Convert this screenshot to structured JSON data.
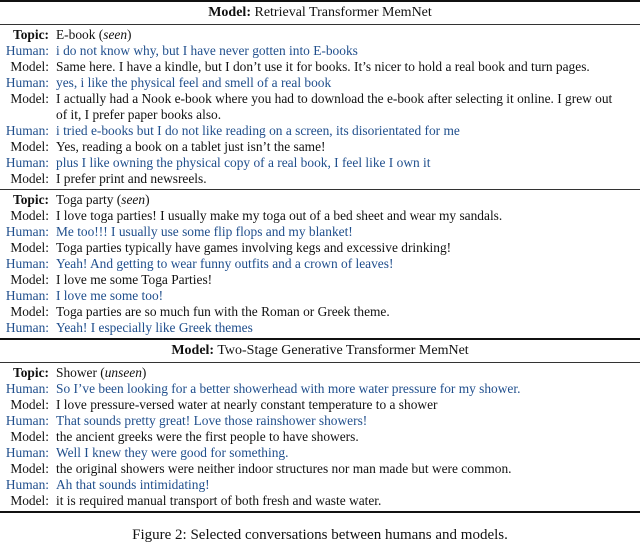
{
  "colors": {
    "human_text": "#1f4e8c",
    "model_text": "#111111"
  },
  "blocks": [
    {
      "model_label": "Model:",
      "model_name": "Retrieval Transformer MemNet",
      "sections": [
        {
          "topic_label": "Topic:",
          "topic": "E-book",
          "topic_status": "seen",
          "turns": [
            {
              "speaker": "Human:",
              "text": "i do not know why, but I have never gotten into E-books"
            },
            {
              "speaker": "Model:",
              "text": "Same here. I have a kindle, but I don’t use it for books. It’s nicer to hold a real book and turn pages."
            },
            {
              "speaker": "Human:",
              "text": "yes, i like the physical feel and smell of a real book"
            },
            {
              "speaker": "Model:",
              "text": "I actually had a Nook e-book where you had to download the e-book after selecting it online. I grew out of it, I prefer paper books also."
            },
            {
              "speaker": "Human:",
              "text": "i tried e-books but I do not like reading on a screen, its disorientated for me"
            },
            {
              "speaker": "Model:",
              "text": "Yes, reading a book on a tablet just isn’t the same!"
            },
            {
              "speaker": "Human:",
              "text": "plus I like owning the physical copy of a real book, I feel like I own it"
            },
            {
              "speaker": "Model:",
              "text": "I prefer print and newsreels."
            }
          ]
        },
        {
          "topic_label": "Topic:",
          "topic": "Toga party",
          "topic_status": "seen",
          "turns": [
            {
              "speaker": "Model:",
              "text": "I love toga parties! I usually make my toga out of a bed sheet and wear my sandals."
            },
            {
              "speaker": "Human:",
              "text": "Me too!!! I usually use some flip flops and my blanket!"
            },
            {
              "speaker": "Model:",
              "text": "Toga parties typically have games involving kegs and excessive drinking!"
            },
            {
              "speaker": "Human:",
              "text": "Yeah! And getting to wear funny outfits and a crown of leaves!"
            },
            {
              "speaker": "Model:",
              "text": "I love me some Toga Parties!"
            },
            {
              "speaker": "Human:",
              "text": "I love me some too!"
            },
            {
              "speaker": "Model:",
              "text": "Toga parties are so much fun with the Roman or Greek theme."
            },
            {
              "speaker": "Human:",
              "text": "Yeah! I especially like Greek themes"
            }
          ]
        }
      ]
    },
    {
      "model_label": "Model:",
      "model_name": "Two-Stage Generative Transformer MemNet",
      "sections": [
        {
          "topic_label": "Topic:",
          "topic": "Shower",
          "topic_status": "unseen",
          "turns": [
            {
              "speaker": "Human:",
              "text": "So I’ve been looking for a better showerhead with more water pressure for my shower."
            },
            {
              "speaker": "Model:",
              "text": "I love pressure-versed water at nearly constant temperature to a shower"
            },
            {
              "speaker": "Human:",
              "text": "That sounds pretty great! Love those rainshower showers!"
            },
            {
              "speaker": "Model:",
              "text": "the ancient greeks were the first people to have showers."
            },
            {
              "speaker": "Human:",
              "text": "Well I knew they were good for something."
            },
            {
              "speaker": "Model:",
              "text": "the original showers were neither indoor structures nor man made but were common."
            },
            {
              "speaker": "Human:",
              "text": "Ah that sounds intimidating!"
            },
            {
              "speaker": "Model:",
              "text": "it is required manual transport of both fresh and waste water."
            }
          ]
        }
      ]
    }
  ],
  "caption": "Figure 2: Selected conversations between humans and models."
}
